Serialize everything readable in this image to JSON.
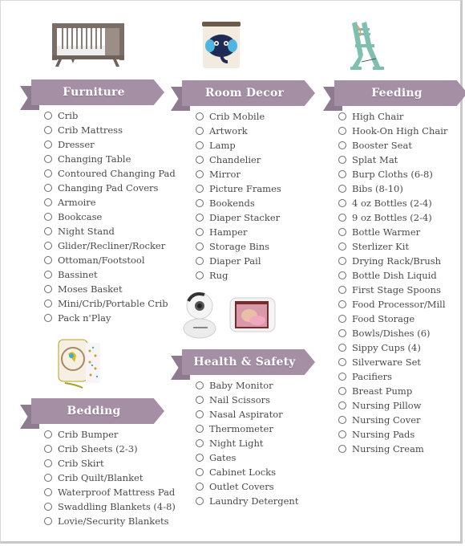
{
  "sections": {
    "furniture": {
      "title": "Furniture",
      "image_icon": "crib-illustration",
      "items": [
        "Crib",
        "Crib Mattress",
        "Dresser",
        "Changing Table",
        "Contoured Changing Pad",
        "Changing Pad Covers",
        "Armoire",
        "Bookcase",
        "Night Stand",
        "Glider/Recliner/Rocker",
        "Ottoman/Footstool",
        "Bassinet",
        "Moses Basket",
        "Mini/Crib/Portable Crib",
        "Pack n'Play"
      ]
    },
    "room_decor": {
      "title": "Room Decor",
      "image_icon": "elephant-storage-bin-illustration",
      "items": [
        "Crib Mobile",
        "Artwork",
        "Lamp",
        "Chandelier",
        "Mirror",
        "Picture Frames",
        "Bookends",
        "Diaper Stacker",
        "Hamper",
        "Storage Bins",
        "Diaper Pail",
        "Rug"
      ]
    },
    "feeding": {
      "title": "Feeding",
      "image_icon": "high-chair-illustration",
      "items": [
        "High Chair",
        "Hook-On High Chair",
        "Booster Seat",
        "Splat Mat",
        "Burp Cloths (6-8)",
        "Bibs (8-10)",
        "4 oz Bottles (2-4)",
        "9 oz Bottles (2-4)",
        "Bottle Warmer",
        "Sterlizer Kit",
        "Drying Rack/Brush",
        "Bottle Dish Liquid",
        "First Stage Spoons",
        "Food Processor/Mill",
        "Food Storage",
        "Bowls/Dishes (6)",
        "Sippy Cups (4)",
        "Silverware Set",
        "Pacifiers",
        "Breast Pump",
        "Nursing Pillow",
        "Nursing Cover",
        "Nursing Pads",
        "Nursing Cream"
      ]
    },
    "health_safety": {
      "title": "Health & Safety",
      "image_icon": "baby-monitor-illustration",
      "items": [
        "Baby Monitor",
        "Nail Scissors",
        "Nasal Aspirator",
        "Thermometer",
        "Night Light",
        "Gates",
        "Cabinet Locks",
        "Outlet Covers",
        "Laundry Detergent"
      ]
    },
    "bedding": {
      "title": "Bedding",
      "image_icon": "crib-bumper-illustration",
      "items": [
        "Crib Bumper",
        "Crib Sheets (2-3)",
        "Crib Skirt",
        "Crib Quilt/Blanket",
        "Waterproof Mattress Pad",
        "Swaddling Blankets (4-8)",
        "Lovie/Security Blankets"
      ]
    }
  },
  "colors": {
    "ribbon": "#a58fa5",
    "ribbon_tail": "#8f7b8f",
    "text": "#4a4a4a"
  }
}
